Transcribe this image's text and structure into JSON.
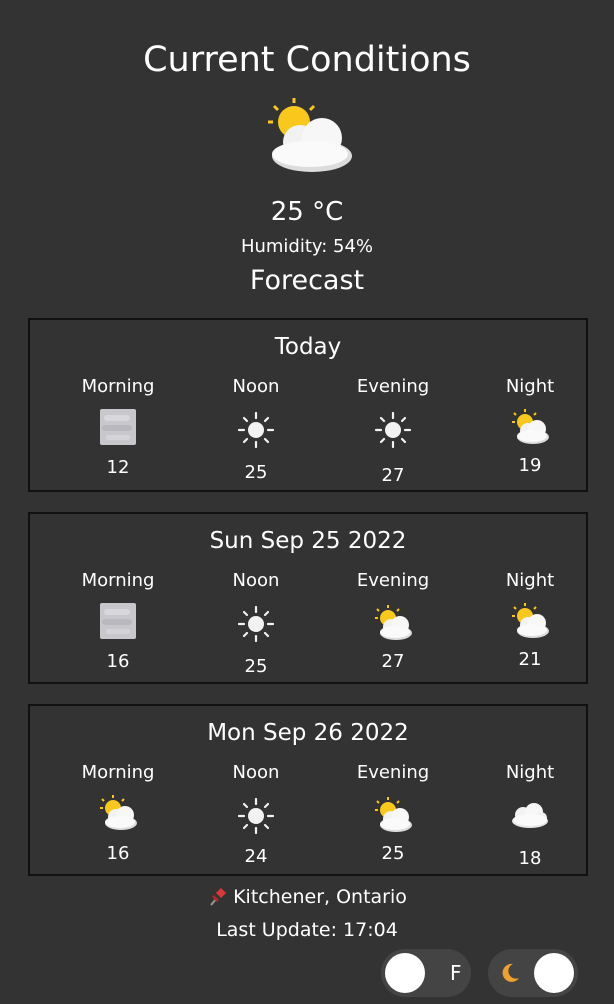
{
  "current": {
    "title": "Current Conditions",
    "icon": "sun-behind-cloud-icon",
    "temperature": "25 °C",
    "humidity": "Humidity: 54%"
  },
  "forecast_title": "Forecast",
  "days": [
    {
      "title": "Today",
      "periods": [
        {
          "label": "Morning",
          "icon": "fog-icon",
          "temp": "12"
        },
        {
          "label": "Noon",
          "icon": "sun-icon",
          "temp": "25"
        },
        {
          "label": "Evening",
          "icon": "sun-icon",
          "temp": "27"
        },
        {
          "label": "Night",
          "icon": "sun-behind-cloud-icon",
          "temp": "19"
        }
      ]
    },
    {
      "title": "Sun Sep 25 2022",
      "periods": [
        {
          "label": "Morning",
          "icon": "fog-icon",
          "temp": "16"
        },
        {
          "label": "Noon",
          "icon": "sun-icon",
          "temp": "25"
        },
        {
          "label": "Evening",
          "icon": "sun-behind-cloud-icon",
          "temp": "27"
        },
        {
          "label": "Night",
          "icon": "sun-behind-cloud-icon",
          "temp": "21"
        }
      ]
    },
    {
      "title": "Mon Sep 26 2022",
      "periods": [
        {
          "label": "Morning",
          "icon": "sun-behind-cloud-icon",
          "temp": "16"
        },
        {
          "label": "Noon",
          "icon": "sun-icon",
          "temp": "24"
        },
        {
          "label": "Evening",
          "icon": "sun-behind-cloud-icon",
          "temp": "25"
        },
        {
          "label": "Night",
          "icon": "cloud-icon",
          "temp": "18"
        }
      ]
    }
  ],
  "location": "Kitchener, Ontario",
  "last_update": "Last Update: 17:04",
  "unit_toggle": {
    "label": "F"
  },
  "colors": {
    "background": "#333333",
    "card_border": "#111111",
    "toggle_track": "#444444",
    "moon": "#f0a030"
  }
}
